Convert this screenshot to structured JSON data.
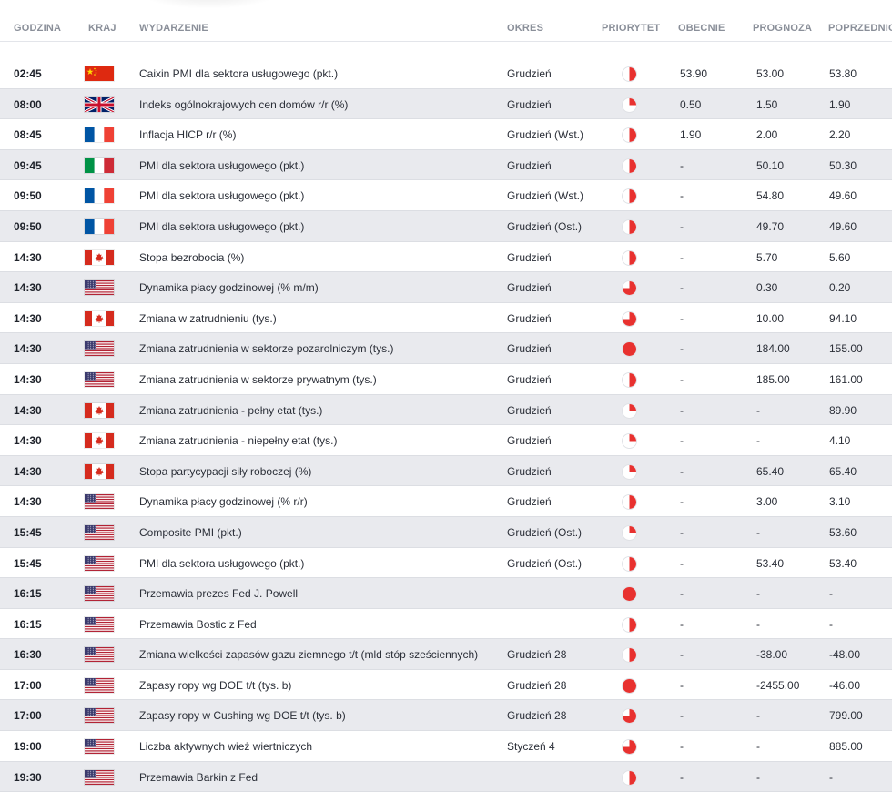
{
  "headers": {
    "time": "GODZINA",
    "country": "KRAJ",
    "event": "WYDARZENIE",
    "period": "OKRES",
    "priority": "PRIORYTET",
    "actual": "OBECNIE",
    "forecast": "PROGNOZA",
    "previous": "POPRZEDNIO"
  },
  "colors": {
    "priority_red": "#e8312f",
    "row_alt": "#e9eaee"
  },
  "rows": [
    {
      "time": "02:45",
      "country": "cn",
      "event": "Caixin PMI dla sektora usługowego (pkt.)",
      "period": "Grudzień",
      "priority": 0.5,
      "actual": "53.90",
      "forecast": "53.00",
      "previous": "53.80"
    },
    {
      "time": "08:00",
      "country": "gb",
      "event": "Indeks ogólnokrajowych cen domów r/r (%)",
      "period": "Grudzień",
      "priority": 0.25,
      "actual": "0.50",
      "forecast": "1.50",
      "previous": "1.90"
    },
    {
      "time": "08:45",
      "country": "fr",
      "event": "Inflacja HICP r/r (%)",
      "period": "Grudzień (Wst.)",
      "priority": 0.5,
      "actual": "1.90",
      "forecast": "2.00",
      "previous": "2.20"
    },
    {
      "time": "09:45",
      "country": "it",
      "event": "PMI dla sektora usługowego (pkt.)",
      "period": "Grudzień",
      "priority": 0.5,
      "actual": "-",
      "forecast": "50.10",
      "previous": "50.30"
    },
    {
      "time": "09:50",
      "country": "fr",
      "event": "PMI dla sektora usługowego (pkt.)",
      "period": "Grudzień (Wst.)",
      "priority": 0.5,
      "actual": "-",
      "forecast": "54.80",
      "previous": "49.60"
    },
    {
      "time": "09:50",
      "country": "fr",
      "event": "PMI dla sektora usługowego (pkt.)",
      "period": "Grudzień (Ost.)",
      "priority": 0.5,
      "actual": "-",
      "forecast": "49.70",
      "previous": "49.60"
    },
    {
      "time": "14:30",
      "country": "ca",
      "event": "Stopa bezrobocia (%)",
      "period": "Grudzień",
      "priority": 0.5,
      "actual": "-",
      "forecast": "5.70",
      "previous": "5.60"
    },
    {
      "time": "14:30",
      "country": "us",
      "event": "Dynamika płacy godzinowej (% m/m)",
      "period": "Grudzień",
      "priority": 0.75,
      "actual": "-",
      "forecast": "0.30",
      "previous": "0.20"
    },
    {
      "time": "14:30",
      "country": "ca",
      "event": "Zmiana w zatrudnieniu (tys.)",
      "period": "Grudzień",
      "priority": 0.75,
      "actual": "-",
      "forecast": "10.00",
      "previous": "94.10"
    },
    {
      "time": "14:30",
      "country": "us",
      "event": "Zmiana zatrudnienia w sektorze pozarolniczym (tys.)",
      "period": "Grudzień",
      "priority": 1.0,
      "actual": "-",
      "forecast": "184.00",
      "previous": "155.00"
    },
    {
      "time": "14:30",
      "country": "us",
      "event": "Zmiana zatrudnienia w sektorze prywatnym (tys.)",
      "period": "Grudzień",
      "priority": 0.5,
      "actual": "-",
      "forecast": "185.00",
      "previous": "161.00"
    },
    {
      "time": "14:30",
      "country": "ca",
      "event": "Zmiana zatrudnienia - pełny etat (tys.)",
      "period": "Grudzień",
      "priority": 0.25,
      "actual": "-",
      "forecast": "-",
      "previous": "89.90"
    },
    {
      "time": "14:30",
      "country": "ca",
      "event": "Zmiana zatrudnienia - niepełny etat (tys.)",
      "period": "Grudzień",
      "priority": 0.25,
      "actual": "-",
      "forecast": "-",
      "previous": "4.10"
    },
    {
      "time": "14:30",
      "country": "ca",
      "event": "Stopa partycypacji siły roboczej (%)",
      "period": "Grudzień",
      "priority": 0.25,
      "actual": "-",
      "forecast": "65.40",
      "previous": "65.40"
    },
    {
      "time": "14:30",
      "country": "us",
      "event": "Dynamika płacy godzinowej (% r/r)",
      "period": "Grudzień",
      "priority": 0.5,
      "actual": "-",
      "forecast": "3.00",
      "previous": "3.10"
    },
    {
      "time": "15:45",
      "country": "us",
      "event": "Composite PMI (pkt.)",
      "period": "Grudzień (Ost.)",
      "priority": 0.25,
      "actual": "-",
      "forecast": "-",
      "previous": "53.60"
    },
    {
      "time": "15:45",
      "country": "us",
      "event": "PMI dla sektora usługowego (pkt.)",
      "period": "Grudzień (Ost.)",
      "priority": 0.5,
      "actual": "-",
      "forecast": "53.40",
      "previous": "53.40"
    },
    {
      "time": "16:15",
      "country": "us",
      "event": "Przemawia prezes Fed J. Powell",
      "period": "",
      "priority": 1.0,
      "actual": "-",
      "forecast": "-",
      "previous": "-"
    },
    {
      "time": "16:15",
      "country": "us",
      "event": "Przemawia Bostic z Fed",
      "period": "",
      "priority": 0.5,
      "actual": "-",
      "forecast": "-",
      "previous": "-"
    },
    {
      "time": "16:30",
      "country": "us",
      "event": "Zmiana wielkości zapasów gazu ziemnego t/t (mld stóp sześciennych)",
      "period": "Grudzień 28",
      "priority": 0.5,
      "actual": "-",
      "forecast": "-38.00",
      "previous": "-48.00"
    },
    {
      "time": "17:00",
      "country": "us",
      "event": "Zapasy ropy wg DOE t/t (tys. b)",
      "period": "Grudzień 28",
      "priority": 1.0,
      "actual": "-",
      "forecast": "-2455.00",
      "previous": "-46.00"
    },
    {
      "time": "17:00",
      "country": "us",
      "event": "Zapasy ropy w Cushing wg DOE t/t (tys. b)",
      "period": "Grudzień 28",
      "priority": 0.75,
      "actual": "-",
      "forecast": "-",
      "previous": "799.00"
    },
    {
      "time": "19:00",
      "country": "us",
      "event": "Liczba aktywnych wież wiertniczych",
      "period": "Styczeń 4",
      "priority": 0.75,
      "actual": "-",
      "forecast": "-",
      "previous": "885.00"
    },
    {
      "time": "19:30",
      "country": "us",
      "event": "Przemawia Barkin z Fed",
      "period": "",
      "priority": 0.5,
      "actual": "-",
      "forecast": "-",
      "previous": "-"
    }
  ]
}
